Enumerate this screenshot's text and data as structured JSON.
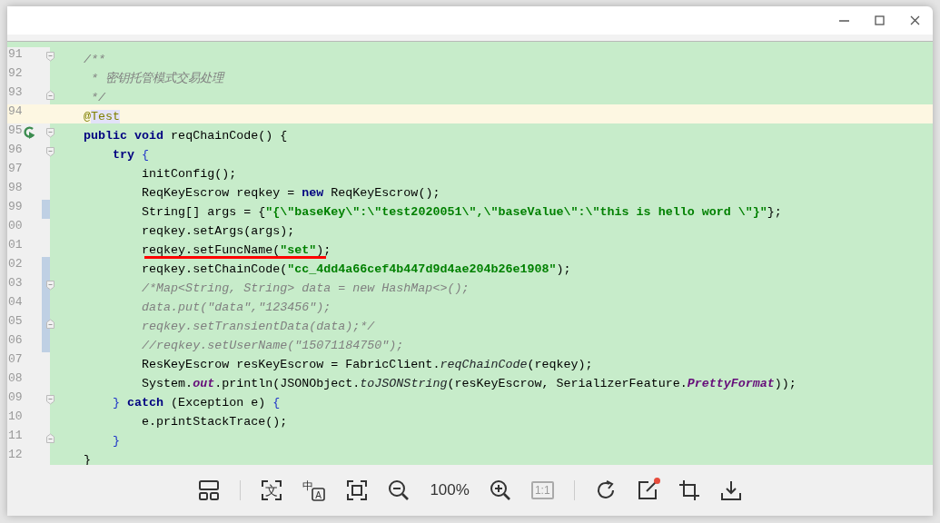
{
  "window": {
    "controls": [
      {
        "kind": "minimize"
      },
      {
        "kind": "maximize"
      },
      {
        "kind": "close"
      }
    ]
  },
  "editor": {
    "lines": [
      {
        "number": "91",
        "fold_start": true,
        "tokens": [
          {
            "kind": "comment",
            "text": "    /**"
          }
        ]
      },
      {
        "number": "92",
        "tokens": [
          {
            "kind": "comment",
            "text": "     * 密钥托管模式交易处理"
          }
        ]
      },
      {
        "number": "93",
        "fold_end": true,
        "tokens": [
          {
            "kind": "comment",
            "text": "     */"
          }
        ]
      },
      {
        "number": "94",
        "current": true,
        "tokens": [
          {
            "kind": "annotation",
            "text": "    @"
          },
          {
            "kind": "annotation-target",
            "text": "Test"
          }
        ]
      },
      {
        "number": "95",
        "run_icon": true,
        "fold_start": true,
        "tokens": [
          {
            "kind": "keyword",
            "text": "    public void"
          },
          {
            "kind": "plain",
            "text": " reqChainCode() {"
          }
        ]
      },
      {
        "number": "96",
        "fold_start": true,
        "tokens": [
          {
            "kind": "keyword",
            "text": "        try"
          },
          {
            "kind": "brace",
            "text": " {"
          }
        ]
      },
      {
        "number": "97",
        "tokens": [
          {
            "kind": "plain",
            "text": "            initConfig();"
          }
        ]
      },
      {
        "number": "98",
        "tokens": [
          {
            "kind": "plain",
            "text": "            ReqKeyEscrow reqkey = "
          },
          {
            "kind": "keyword",
            "text": "new"
          },
          {
            "kind": "plain",
            "text": " ReqKeyEscrow();"
          }
        ]
      },
      {
        "number": "99",
        "changed": true,
        "tokens": [
          {
            "kind": "plain",
            "text": "            String[] args = {"
          },
          {
            "kind": "string",
            "text": "\"{\\\"baseKey\\\":\\\"test2020051\\\",\\\"baseValue\\\":\\\"this is hello word \\\"}\""
          },
          {
            "kind": "plain",
            "text": "};"
          }
        ]
      },
      {
        "number": "00",
        "tokens": [
          {
            "kind": "plain",
            "text": "            reqkey.setArgs(args);"
          }
        ]
      },
      {
        "number": "01",
        "underlined": true,
        "tokens": [
          {
            "kind": "plain",
            "text": "            reqkey.setFuncName("
          },
          {
            "kind": "string",
            "text": "\"set\""
          },
          {
            "kind": "plain",
            "text": ");"
          }
        ]
      },
      {
        "number": "02",
        "changed": true,
        "tokens": [
          {
            "kind": "plain",
            "text": "            reqkey.setChainCode("
          },
          {
            "kind": "string",
            "text": "\"cc_4dd4a66cef4b447d9d4ae204b26e1908\""
          },
          {
            "kind": "plain",
            "text": ");"
          }
        ]
      },
      {
        "number": "03",
        "changed": true,
        "fold_start": true,
        "tokens": [
          {
            "kind": "comment",
            "text": "            /*Map<String, String> data = new HashMap<>();"
          }
        ]
      },
      {
        "number": "04",
        "changed": true,
        "tokens": [
          {
            "kind": "comment",
            "text": "            data.put(\"data\",\"123456\");"
          }
        ]
      },
      {
        "number": "05",
        "changed": true,
        "fold_end": true,
        "tokens": [
          {
            "kind": "comment",
            "text": "            reqkey.setTransientData(data);*/"
          }
        ]
      },
      {
        "number": "06",
        "changed": true,
        "tokens": [
          {
            "kind": "comment",
            "text": "            //reqkey.setUserName(\"15071184750\");"
          }
        ]
      },
      {
        "number": "07",
        "tokens": [
          {
            "kind": "plain",
            "text": "            ResKeyEscrow resKeyEscrow = FabricClient."
          },
          {
            "kind": "static",
            "text": "reqChainCode"
          },
          {
            "kind": "plain",
            "text": "(reqkey);"
          }
        ]
      },
      {
        "number": "08",
        "tokens": [
          {
            "kind": "plain",
            "text": "            System."
          },
          {
            "kind": "field",
            "text": "out"
          },
          {
            "kind": "plain",
            "text": ".println(JSONObject."
          },
          {
            "kind": "static",
            "text": "toJSONString"
          },
          {
            "kind": "plain",
            "text": "(resKeyEscrow, SerializerFeature."
          },
          {
            "kind": "field",
            "text": "PrettyFormat"
          },
          {
            "kind": "plain",
            "text": "));"
          }
        ]
      },
      {
        "number": "09",
        "fold_start": true,
        "tokens": [
          {
            "kind": "brace",
            "text": "        }"
          },
          {
            "kind": "keyword",
            "text": " catch"
          },
          {
            "kind": "plain",
            "text": " (Exception e) "
          },
          {
            "kind": "brace",
            "text": "{"
          }
        ]
      },
      {
        "number": "10",
        "tokens": [
          {
            "kind": "plain",
            "text": "            e.printStackTrace();"
          }
        ]
      },
      {
        "number": "11",
        "fold_end": true,
        "tokens": [
          {
            "kind": "brace",
            "text": "        }"
          }
        ]
      },
      {
        "number": "12",
        "tokens": [
          {
            "kind": "plain",
            "text": "    }"
          }
        ]
      }
    ]
  },
  "toolbar": {
    "items": [
      {
        "kind": "layout"
      },
      {
        "kind": "separator"
      },
      {
        "kind": "ocr",
        "glyph": "文"
      },
      {
        "kind": "translate",
        "glyph": "中",
        "glyph_2": "A"
      },
      {
        "kind": "fit"
      },
      {
        "kind": "zoom-out"
      },
      {
        "kind": "zoom-level",
        "text": "100%"
      },
      {
        "kind": "zoom-in"
      },
      {
        "kind": "actual-size",
        "text": "1:1",
        "disabled": true
      },
      {
        "kind": "separator"
      },
      {
        "kind": "rotate"
      },
      {
        "kind": "edit",
        "dot": true
      },
      {
        "kind": "crop"
      },
      {
        "kind": "download"
      }
    ]
  }
}
